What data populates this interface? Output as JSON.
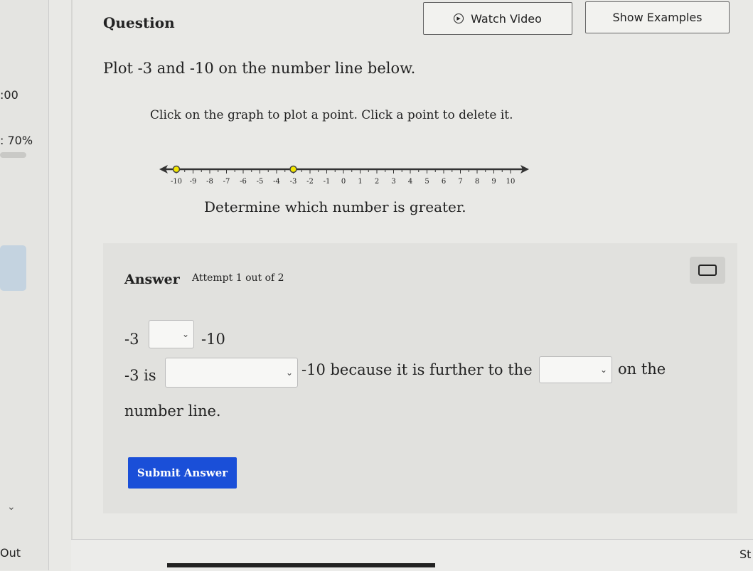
{
  "sidebar": {
    "timer": ":00",
    "score": ": 70%",
    "score_value": 70,
    "out_label": "Out"
  },
  "header": {
    "title": "Question",
    "watch_video": "Watch Video",
    "show_examples": "Show Examples"
  },
  "question": {
    "prompt": "Plot -3 and -10 on the number line below.",
    "instruction": "Click on the graph to plot a point. Click a point to delete it.",
    "followup": "Determine which number is greater."
  },
  "number_line": {
    "min": -10,
    "max": 10,
    "ticks": [
      -10,
      -9,
      -8,
      -7,
      -6,
      -5,
      -4,
      -3,
      -2,
      -1,
      0,
      1,
      2,
      3,
      4,
      5,
      6,
      7,
      8,
      9,
      10
    ],
    "plotted_points": [
      -10,
      -3
    ],
    "point_color": "#f2e600"
  },
  "answer": {
    "label": "Answer",
    "attempt": "Attempt 1 out of 2",
    "line1_left": "-3",
    "line1_right": "-10",
    "line2_start": "-3 is",
    "line2_mid": "-10 because it is further to the",
    "line2_end": "on the",
    "line3": "number line.",
    "submit": "Submit Answer",
    "submit_color": "#1a4fd8"
  },
  "footer": {
    "right_fragment": "St"
  }
}
